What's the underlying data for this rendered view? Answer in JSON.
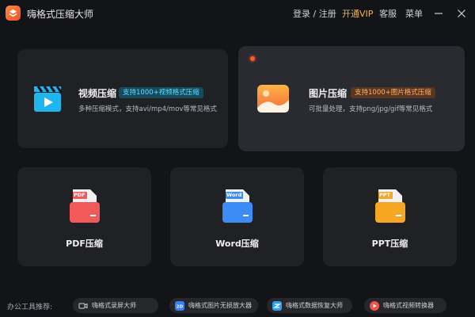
{
  "app": {
    "title": "嗨格式压缩大师"
  },
  "nav": {
    "login": "登录 / 注册",
    "vip": "开通VIP",
    "service": "客服",
    "menu": "菜单"
  },
  "colors": {
    "accent": "#f3b44a",
    "video_blue": "#1fb6f0",
    "image_orange": "#ff8a4a",
    "pdf_red": "#f25a5a",
    "word_blue": "#3d8bf5",
    "ppt_orange": "#f5a623"
  },
  "cards": {
    "video": {
      "title": "视频压缩",
      "badge": "支持1000+视频格式压缩",
      "desc": "多种压缩模式，支持avi/mp4/mov等常见格式",
      "icon": "clapperboard-icon"
    },
    "image": {
      "title": "图片压缩",
      "badge": "支持1000+图片格式压缩",
      "desc": "可批量处理，支持png/jpg/gif等常见格式",
      "icon": "image-icon"
    },
    "pdf": {
      "label": "PDF压缩",
      "file_tag": "PDF",
      "icon": "pdf-file-icon"
    },
    "word": {
      "label": "Word压缩",
      "file_tag": "Word",
      "icon": "word-file-icon"
    },
    "ppt": {
      "label": "PPT压缩",
      "file_tag": "PPT",
      "icon": "ppt-file-icon"
    }
  },
  "footer": {
    "label": "办公工具推荐:",
    "tools": [
      {
        "label": "嗨格式录屏大师",
        "icon": "video-camera-icon"
      },
      {
        "label": "嗨格式图片无损放大器",
        "icon": "image-enlarger-icon"
      },
      {
        "label": "嗨格式数据恢复大师",
        "icon": "data-recovery-icon"
      },
      {
        "label": "嗨格式视频转换器",
        "icon": "video-converter-icon"
      }
    ]
  }
}
